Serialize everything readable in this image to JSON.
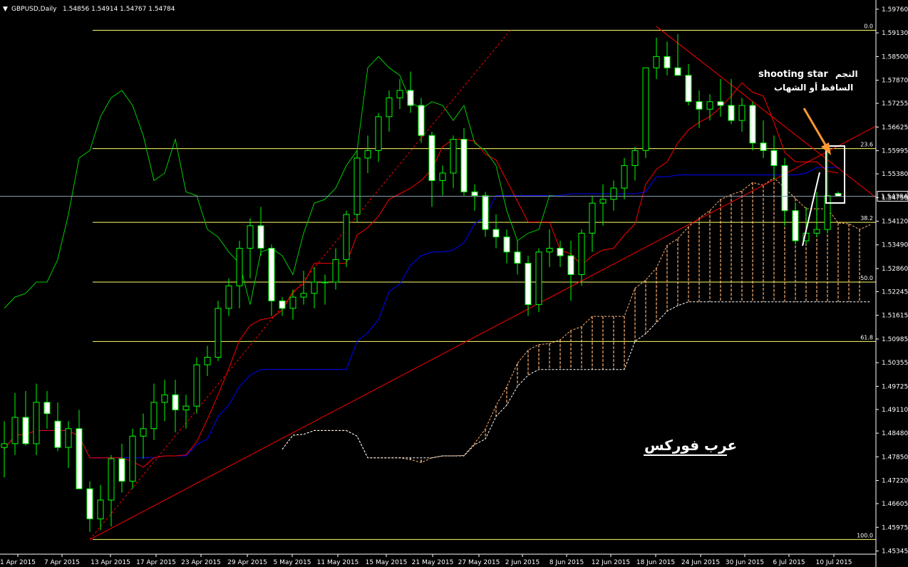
{
  "header": {
    "symbol": "GBPUSD,Daily",
    "ohlc": "1.54856 1.54914 1.54767 1.54784"
  },
  "colors": {
    "background": "#000000",
    "grid_fib": "#ffff66",
    "tenkan": "#ff0000",
    "kijun": "#0000ff",
    "chikou": "#00cc00",
    "trendline": "#ff0000",
    "cloud_bull": "#ffb070",
    "cloud_bear": "#ffffff",
    "bull_candle": "#000000",
    "bear_candle": "#ffffff",
    "wick": "#00ff00",
    "arrow": "#ff9933"
  },
  "annotations": {
    "shooting_star_en": "shooting star",
    "shooting_star_ar1": "النجم",
    "shooting_star_ar2": "الساقط أو الشهاب",
    "watermark": "عرب فوركس"
  },
  "chart_data": {
    "type": "candlestick",
    "title": "",
    "current_price": "1.54784",
    "price_axis": {
      "ylim": [
        1.4526,
        1.5991
      ],
      "ticks": [
        "1.59760",
        "1.59130",
        "1.58500",
        "1.57870",
        "1.57255",
        "1.56625",
        "1.55995",
        "1.55380",
        "1.54750",
        "1.54120",
        "1.53490",
        "1.52860",
        "1.52245",
        "1.51615",
        "1.50985",
        "1.50355",
        "1.49725",
        "1.49110",
        "1.48480",
        "1.47850",
        "1.47220",
        "1.46605",
        "1.45975",
        "1.45345"
      ]
    },
    "date_axis": {
      "ticks": [
        "1 Apr 2015",
        "7 Apr 2015",
        "13 Apr 2015",
        "17 Apr 2015",
        "23 Apr 2015",
        "29 Apr 2015",
        "5 May 2015",
        "11 May 2015",
        "15 May 2015",
        "21 May 2015",
        "27 May 2015",
        "2 Jun 2015",
        "8 Jun 2015",
        "12 Jun 2015",
        "18 Jun 2015",
        "24 Jun 2015",
        "30 Jun 2015",
        "6 Jul 2015",
        "10 Jul 2015"
      ]
    },
    "fibonacci": [
      {
        "level": "0.0",
        "price": 1.592
      },
      {
        "level": "23.6",
        "price": 1.5605
      },
      {
        "level": "38.2",
        "price": 1.5409
      },
      {
        "level": "50.0",
        "price": 1.525
      },
      {
        "level": "61.8",
        "price": 1.5092
      },
      {
        "level": "100.0",
        "price": 1.4565
      }
    ],
    "candles": [
      [
        1.481,
        1.488,
        1.473,
        1.482
      ],
      [
        1.482,
        1.4955,
        1.479,
        1.489
      ],
      [
        1.489,
        1.496,
        1.4815,
        1.482
      ],
      [
        1.482,
        1.498,
        1.479,
        1.493
      ],
      [
        1.493,
        1.496,
        1.486,
        1.49
      ],
      [
        1.488,
        1.493,
        1.48,
        1.481
      ],
      [
        1.481,
        1.488,
        1.4755,
        1.486
      ],
      [
        1.486,
        1.491,
        1.47,
        1.47
      ],
      [
        1.47,
        1.472,
        1.4585,
        1.462
      ],
      [
        1.462,
        1.471,
        1.459,
        1.467
      ],
      [
        1.467,
        1.479,
        1.46,
        1.478
      ],
      [
        1.478,
        1.482,
        1.469,
        1.472
      ],
      [
        1.472,
        1.486,
        1.47,
        1.484
      ],
      [
        1.484,
        1.49,
        1.478,
        1.486
      ],
      [
        1.486,
        1.498,
        1.483,
        1.493
      ],
      [
        1.493,
        1.499,
        1.488,
        1.495
      ],
      [
        1.495,
        1.499,
        1.485,
        1.491
      ],
      [
        1.491,
        1.495,
        1.486,
        1.492
      ],
      [
        1.492,
        1.505,
        1.49,
        1.503
      ],
      [
        1.503,
        1.508,
        1.5,
        1.505
      ],
      [
        1.505,
        1.52,
        1.504,
        1.518
      ],
      [
        1.518,
        1.526,
        1.516,
        1.524
      ],
      [
        1.524,
        1.536,
        1.518,
        1.534
      ],
      [
        1.534,
        1.542,
        1.526,
        1.54
      ],
      [
        1.54,
        1.545,
        1.532,
        1.534
      ],
      [
        1.534,
        1.535,
        1.516,
        1.52
      ],
      [
        1.52,
        1.521,
        1.516,
        1.518
      ],
      [
        1.518,
        1.523,
        1.515,
        1.521
      ],
      [
        1.521,
        1.528,
        1.519,
        1.522
      ],
      [
        1.522,
        1.529,
        1.518,
        1.525
      ],
      [
        1.525,
        1.527,
        1.519,
        1.525
      ],
      [
        1.525,
        1.534,
        1.523,
        1.531
      ],
      [
        1.531,
        1.544,
        1.529,
        1.543
      ],
      [
        1.543,
        1.56,
        1.541,
        1.558
      ],
      [
        1.558,
        1.564,
        1.554,
        1.56
      ],
      [
        1.56,
        1.57,
        1.557,
        1.569
      ],
      [
        1.569,
        1.576,
        1.565,
        1.574
      ],
      [
        1.574,
        1.579,
        1.571,
        1.576
      ],
      [
        1.576,
        1.581,
        1.57,
        1.572
      ],
      [
        1.572,
        1.574,
        1.562,
        1.564
      ],
      [
        1.564,
        1.565,
        1.545,
        1.552
      ],
      [
        1.552,
        1.556,
        1.548,
        1.554
      ],
      [
        1.554,
        1.564,
        1.55,
        1.563
      ],
      [
        1.563,
        1.566,
        1.548,
        1.549
      ],
      [
        1.549,
        1.551,
        1.544,
        1.548
      ],
      [
        1.548,
        1.549,
        1.537,
        1.539
      ],
      [
        1.539,
        1.543,
        1.534,
        1.537
      ],
      [
        1.537,
        1.539,
        1.53,
        1.533
      ],
      [
        1.533,
        1.536,
        1.527,
        1.53
      ],
      [
        1.53,
        1.532,
        1.516,
        1.519
      ],
      [
        1.519,
        1.534,
        1.517,
        1.533
      ],
      [
        1.533,
        1.539,
        1.529,
        1.534
      ],
      [
        1.534,
        1.536,
        1.529,
        1.532
      ],
      [
        1.532,
        1.536,
        1.52,
        1.527
      ],
      [
        1.527,
        1.539,
        1.524,
        1.538
      ],
      [
        1.538,
        1.548,
        1.533,
        1.546
      ],
      [
        1.546,
        1.551,
        1.54,
        1.547
      ],
      [
        1.547,
        1.552,
        1.544,
        1.55
      ],
      [
        1.55,
        1.558,
        1.547,
        1.556
      ],
      [
        1.556,
        1.561,
        1.552,
        1.56
      ],
      [
        1.56,
        1.582,
        1.558,
        1.582
      ],
      [
        1.582,
        1.59,
        1.579,
        1.585
      ],
      [
        1.585,
        1.589,
        1.58,
        1.582
      ],
      [
        1.582,
        1.591,
        1.581,
        1.58
      ],
      [
        1.58,
        1.583,
        1.572,
        1.573
      ],
      [
        1.573,
        1.576,
        1.566,
        1.571
      ],
      [
        1.571,
        1.575,
        1.568,
        1.573
      ],
      [
        1.573,
        1.579,
        1.569,
        1.572
      ],
      [
        1.572,
        1.579,
        1.567,
        1.568
      ],
      [
        1.568,
        1.574,
        1.565,
        1.572
      ],
      [
        1.572,
        1.573,
        1.56,
        1.562
      ],
      [
        1.562,
        1.568,
        1.558,
        1.56
      ],
      [
        1.56,
        1.564,
        1.552,
        1.556
      ],
      [
        1.556,
        1.558,
        1.54,
        1.544
      ],
      [
        1.544,
        1.546,
        1.535,
        1.536
      ],
      [
        1.536,
        1.545,
        1.535,
        1.538
      ],
      [
        1.538,
        1.549,
        1.537,
        1.539
      ],
      [
        1.539,
        1.561,
        1.538,
        1.548
      ],
      [
        1.5486,
        1.5491,
        1.5477,
        1.5478
      ]
    ]
  }
}
